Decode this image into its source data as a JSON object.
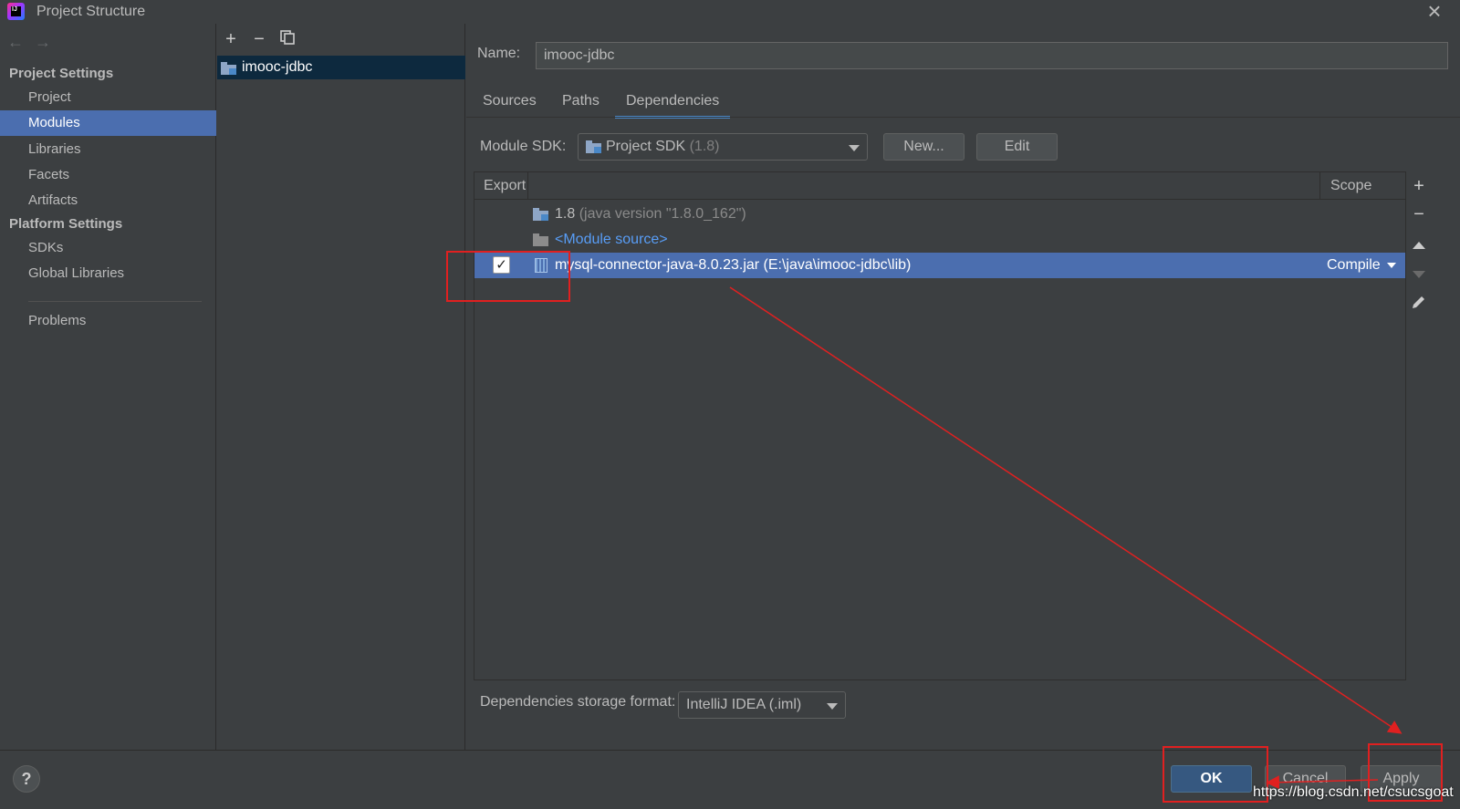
{
  "window": {
    "title": "Project Structure",
    "app_icon_text": "IJ"
  },
  "sidebar": {
    "back_icon": "arrow-left-icon",
    "forward_icon": "arrow-right-icon",
    "project_settings_header": "Project Settings",
    "project_items": [
      {
        "label": "Project"
      },
      {
        "label": "Modules",
        "selected": true
      },
      {
        "label": "Libraries"
      },
      {
        "label": "Facets"
      },
      {
        "label": "Artifacts"
      }
    ],
    "platform_settings_header": "Platform Settings",
    "platform_items": [
      {
        "label": "SDKs"
      },
      {
        "label": "Global Libraries"
      }
    ],
    "problems_label": "Problems"
  },
  "module_list": {
    "toolbar": [
      "plus-icon",
      "minus-icon",
      "copy-icon"
    ],
    "items": [
      {
        "label": "imooc-jdbc",
        "selected": true
      }
    ]
  },
  "main": {
    "name_label": "Name:",
    "name_value": "imooc-jdbc",
    "tabs": [
      {
        "label": "Sources"
      },
      {
        "label": "Paths"
      },
      {
        "label": "Dependencies",
        "active": true
      }
    ],
    "module_sdk_label": "Module SDK:",
    "module_sdk_value": "Project SDK",
    "module_sdk_version": "(1.8)",
    "new_button": "New...",
    "edit_button": "Edit",
    "table": {
      "col_export": "Export",
      "col_scope": "Scope",
      "rows": [
        {
          "name": "1.8",
          "detail": "(java version \"1.8.0_162\")",
          "icon": "sdk-folder-icon"
        },
        {
          "name": "<Module source>",
          "icon": "module-source-icon"
        },
        {
          "name": "mysql-connector-java-8.0.23.jar (E:\\java\\imooc-jdbc\\lib)",
          "icon": "jar-icon",
          "exported": true,
          "scope": "Compile",
          "selected": true
        }
      ]
    },
    "side_tools": [
      "plus-icon",
      "minus-icon",
      "move-up-icon",
      "move-down-icon",
      "edit-pencil-icon"
    ],
    "storage_label": "Dependencies storage format:",
    "storage_value": "IntelliJ IDEA (.iml)"
  },
  "footer": {
    "help": "?",
    "ok": "OK",
    "cancel": "Cancel",
    "apply": "Apply"
  },
  "watermark": "https://blog.csdn.net/csucsgoat",
  "colors": {
    "background": "#3c3f41",
    "selection": "#4b6eaf",
    "module_selection": "#0d293e",
    "link": "#589df6",
    "annotation_red": "#e02020"
  }
}
